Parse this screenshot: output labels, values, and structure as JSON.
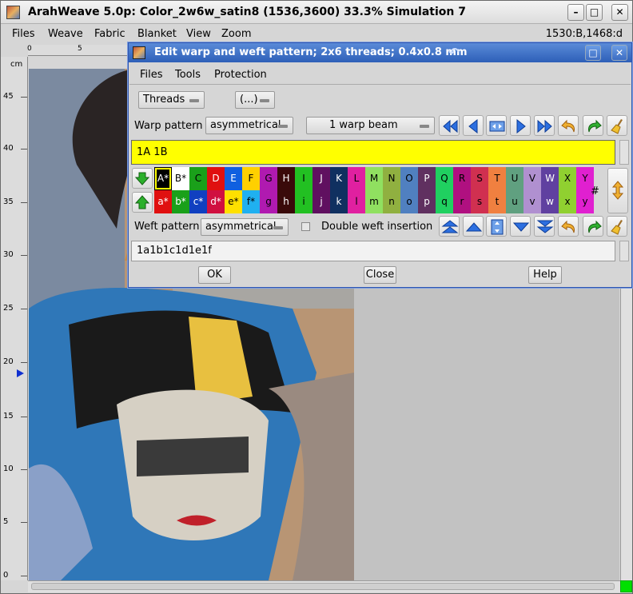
{
  "app": {
    "title": "ArahWeave 5.0p: Color_2w6w_satin8 (1536,3600) 33.3% Simulation 7",
    "menu": [
      "Files",
      "Weave",
      "Fabric",
      "Blanket",
      "View",
      "Zoom"
    ],
    "status": "1530:B,1468:d",
    "ruler_unit": "cm",
    "top_ticks": [
      "0",
      "5"
    ],
    "left_ticks": [
      "45",
      "40",
      "35",
      "30",
      "25",
      "20",
      "15",
      "10",
      "5",
      "0"
    ]
  },
  "dialog": {
    "title": "Edit warp and weft pattern; 2x6 threads; 0.4x0.8 mm",
    "menu": [
      "Files",
      "Tools",
      "Protection"
    ],
    "threads_label": "Threads",
    "paren_label": "(...)",
    "warp_pattern_label": "Warp pattern",
    "warp_pattern_value": "asymmetrical",
    "warp_beam_value": "1 warp beam",
    "warp_text": "1A 1B",
    "weft_pattern_label": "Weft pattern",
    "weft_pattern_value": "asymmetrical",
    "double_weft_label": "Double weft insertion",
    "weft_text": "1a1b1c1d1e1f",
    "hash_label": "#",
    "ok_label": "OK",
    "close_label": "Close",
    "help_label": "Help"
  },
  "palette": {
    "top": [
      {
        "t": "A*",
        "c": "#000000",
        "f": "#ffffff"
      },
      {
        "t": "B*",
        "c": "#ffffff",
        "f": "#000000"
      },
      {
        "t": "C",
        "c": "#1aa01a",
        "f": "#000000"
      },
      {
        "t": "D",
        "c": "#e01010",
        "f": "#ffffff"
      },
      {
        "t": "E",
        "c": "#1060e0",
        "f": "#ffffff"
      },
      {
        "t": "F",
        "c": "#ffd000",
        "f": "#000000"
      },
      {
        "t": "G",
        "c": "#b01ab0",
        "f": "#000000"
      },
      {
        "t": "H",
        "c": "#3a0a0a",
        "f": "#ffffff"
      },
      {
        "t": "I",
        "c": "#22c022",
        "f": "#000000"
      },
      {
        "t": "J",
        "c": "#601060",
        "f": "#ffffff"
      },
      {
        "t": "K",
        "c": "#103060",
        "f": "#ffffff"
      },
      {
        "t": "L",
        "c": "#e020a0",
        "f": "#000000"
      },
      {
        "t": "M",
        "c": "#90e060",
        "f": "#000000"
      },
      {
        "t": "N",
        "c": "#90b040",
        "f": "#000000"
      },
      {
        "t": "O",
        "c": "#5080c0",
        "f": "#000000"
      },
      {
        "t": "P",
        "c": "#603060",
        "f": "#ffffff"
      },
      {
        "t": "Q",
        "c": "#20d060",
        "f": "#000000"
      },
      {
        "t": "R",
        "c": "#b01080",
        "f": "#000000"
      },
      {
        "t": "S",
        "c": "#d03050",
        "f": "#000000"
      },
      {
        "t": "T",
        "c": "#f08040",
        "f": "#000000"
      },
      {
        "t": "U",
        "c": "#60a080",
        "f": "#000000"
      },
      {
        "t": "V",
        "c": "#b090d0",
        "f": "#000000"
      },
      {
        "t": "W",
        "c": "#6040a0",
        "f": "#ffffff"
      },
      {
        "t": "X",
        "c": "#90d030",
        "f": "#000000"
      },
      {
        "t": "Y",
        "c": "#e020d0",
        "f": "#000000"
      }
    ],
    "bottom": [
      {
        "t": "a*",
        "c": "#e01010",
        "f": "#ffffff"
      },
      {
        "t": "b*",
        "c": "#1aa01a",
        "f": "#ffffff"
      },
      {
        "t": "c*",
        "c": "#1040c0",
        "f": "#ffffff"
      },
      {
        "t": "d*",
        "c": "#d01040",
        "f": "#ffffff"
      },
      {
        "t": "e*",
        "c": "#ffe000",
        "f": "#000000"
      },
      {
        "t": "f*",
        "c": "#20b0f0",
        "f": "#000000"
      },
      {
        "t": "g",
        "c": "#b01ab0",
        "f": "#000000"
      },
      {
        "t": "h",
        "c": "#3a0a0a",
        "f": "#ffffff"
      },
      {
        "t": "i",
        "c": "#22c022",
        "f": "#000000"
      },
      {
        "t": "j",
        "c": "#601060",
        "f": "#ffffff"
      },
      {
        "t": "k",
        "c": "#103060",
        "f": "#ffffff"
      },
      {
        "t": "l",
        "c": "#e020a0",
        "f": "#000000"
      },
      {
        "t": "m",
        "c": "#90e060",
        "f": "#000000"
      },
      {
        "t": "n",
        "c": "#90b040",
        "f": "#000000"
      },
      {
        "t": "o",
        "c": "#5080c0",
        "f": "#000000"
      },
      {
        "t": "p",
        "c": "#603060",
        "f": "#ffffff"
      },
      {
        "t": "q",
        "c": "#20d060",
        "f": "#000000"
      },
      {
        "t": "r",
        "c": "#b01080",
        "f": "#000000"
      },
      {
        "t": "s",
        "c": "#d03050",
        "f": "#000000"
      },
      {
        "t": "t",
        "c": "#f08040",
        "f": "#000000"
      },
      {
        "t": "u",
        "c": "#60a080",
        "f": "#000000"
      },
      {
        "t": "v",
        "c": "#b090d0",
        "f": "#000000"
      },
      {
        "t": "w",
        "c": "#6040a0",
        "f": "#ffffff"
      },
      {
        "t": "x",
        "c": "#90d030",
        "f": "#000000"
      },
      {
        "t": "y",
        "c": "#e020d0",
        "f": "#000000"
      }
    ]
  },
  "icons": {
    "warp_toolbar": [
      "first-icon",
      "prev-icon",
      "fit-icon",
      "next-icon",
      "last-icon",
      "undo-icon",
      "redo-icon",
      "broom-icon"
    ],
    "weft_toolbar": [
      "top-icon",
      "up-icon",
      "fit-vertical-icon",
      "down-icon",
      "bottom-icon",
      "undo-icon",
      "redo-icon",
      "broom-icon"
    ]
  },
  "colors": {
    "accent": "#2d5fb8",
    "highlight": "#ffff00",
    "window_bg": "#d6d6d6"
  }
}
